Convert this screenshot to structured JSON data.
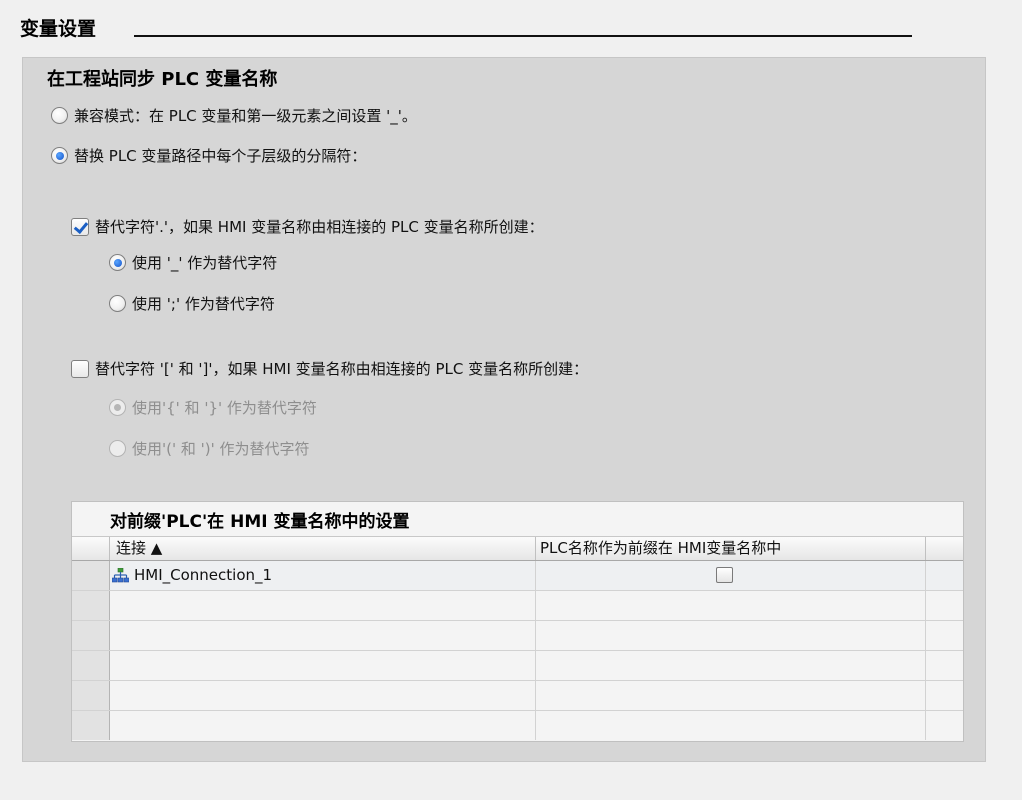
{
  "section": {
    "title": "变量设置"
  },
  "panel": {
    "title": "在工程站同步 PLC 变量名称",
    "mode_compat": {
      "label": "兼容模式：在 PLC 变量和第一级元素之间设置 '_'。",
      "selected": false
    },
    "mode_replace": {
      "label": "替换 PLC 变量路径中每个子层级的分隔符：",
      "selected": true
    },
    "dot_group": {
      "checkbox_label": "替代字符'.'，如果 HMI 变量名称由相连接的 PLC 变量名称所创建：",
      "checked": true,
      "options": [
        {
          "label": "使用 '_' 作为替代字符",
          "selected": true
        },
        {
          "label": "使用 ';' 作为替代字符",
          "selected": false
        }
      ]
    },
    "bracket_group": {
      "checkbox_label": "替代字符 '[' 和 ']'，如果 HMI 变量名称由相连接的 PLC 变量名称所创建：",
      "checked": false,
      "options": [
        {
          "label": "使用'{' 和 '}' 作为替代字符",
          "selected": true
        },
        {
          "label": "使用'(' 和 ')' 作为替代字符",
          "selected": false
        }
      ]
    }
  },
  "prefix_table": {
    "title": "对前缀'PLC'在 HMI 变量名称中的设置",
    "columns": [
      "连接 ▲",
      "PLC名称作为前缀在 HMI变量名称中"
    ],
    "rows": [
      {
        "connection": "HMI_Connection_1",
        "prefix": false,
        "icon": "network-connection-icon"
      }
    ]
  },
  "colors": {
    "panel_bg": "#d6d6d6",
    "radio_selected": "#1553c9",
    "checkmark": "#1b5fc4",
    "disabled_text": "#8e8e8e"
  }
}
